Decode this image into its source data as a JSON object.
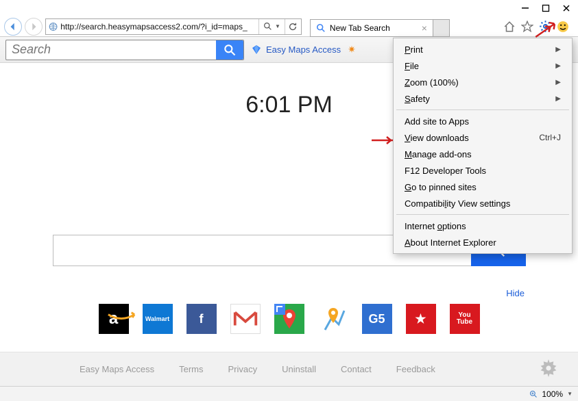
{
  "window_controls": {
    "min": "—",
    "max": "☐",
    "close": "✕"
  },
  "nav": {
    "url": "http://search.heasymapsaccess2.com/?i_id=maps_",
    "tab_placeholder": "New Tab Search"
  },
  "toolbar": {
    "search_placeholder": "Search",
    "easy_maps_label": "Easy Maps Access"
  },
  "clock": "6:01 PM",
  "hide_label": "Hide",
  "tiles": [
    {
      "name": "amazon",
      "bg": "#000",
      "text": "a",
      "fg": "#f5a623"
    },
    {
      "name": "walmart",
      "bg": "#0e78d4",
      "text": "Walmart",
      "fg": "#fff",
      "fs": "9"
    },
    {
      "name": "facebook",
      "bg": "#3b5998",
      "text": "f",
      "fg": "#fff"
    },
    {
      "name": "gmail",
      "bg": "#fff",
      "text": "M",
      "fg": "#d84a3e"
    },
    {
      "name": "google-maps",
      "bg": "#2aa84a",
      "text": "",
      "fg": "#fff"
    },
    {
      "name": "maps-pin",
      "bg": "#fff",
      "text": "",
      "fg": "#f5a623"
    },
    {
      "name": "g5",
      "bg": "#2f6fd0",
      "text": "G5",
      "fg": "#fff"
    },
    {
      "name": "macys",
      "bg": "#d8191f",
      "text": "★",
      "fg": "#fff"
    },
    {
      "name": "youtube",
      "bg": "#d8191f",
      "text": "You\nTube",
      "fg": "#fff",
      "fs": "10"
    }
  ],
  "footer_links": [
    "Easy Maps Access",
    "Terms",
    "Privacy",
    "Uninstall",
    "Contact",
    "Feedback"
  ],
  "menu": {
    "groups": [
      [
        {
          "label": "Print",
          "u": "P",
          "sub": true
        },
        {
          "label": "File",
          "u": "F",
          "sub": true
        },
        {
          "label": "Zoom (100%)",
          "u": "Z",
          "sub": true
        },
        {
          "label": "Safety",
          "u": "S",
          "sub": true
        }
      ],
      [
        {
          "label": "Add site to Apps",
          "u": ""
        },
        {
          "label": "View downloads",
          "u": "V",
          "shortcut": "Ctrl+J"
        },
        {
          "label": "Manage add-ons",
          "u": "M"
        },
        {
          "label": "F12 Developer Tools",
          "u": ""
        },
        {
          "label": "Go to pinned sites",
          "u": "G"
        },
        {
          "label": "Compatibility View settings",
          "u": "b",
          "upos": 9
        }
      ],
      [
        {
          "label": "Internet options",
          "u": "o",
          "upos": 9
        },
        {
          "label": "About Internet Explorer",
          "u": "A"
        }
      ]
    ]
  },
  "status": {
    "zoom": "100%"
  }
}
